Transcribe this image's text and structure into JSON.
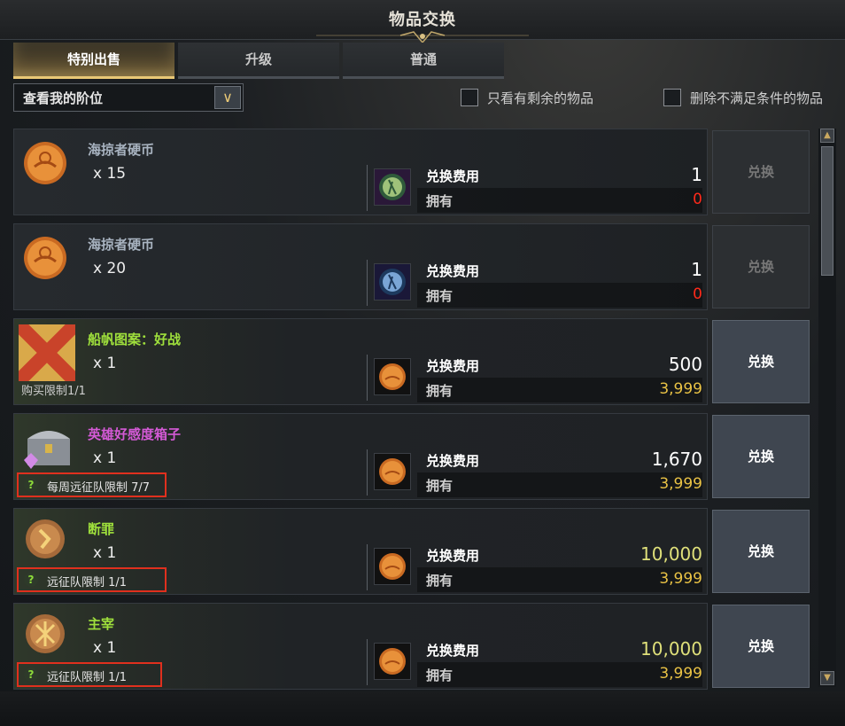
{
  "window": {
    "title": "物品交换"
  },
  "tabs": [
    {
      "label": "特别出售",
      "active": true
    },
    {
      "label": "升级",
      "active": false
    },
    {
      "label": "普通",
      "active": false
    }
  ],
  "filters": {
    "rank_select": "查看我的阶位",
    "only_remaining": "只看有剩余的物品",
    "remove_unmet": "删除不满足条件的物品"
  },
  "labels": {
    "cost": "兑换费用",
    "own": "拥有",
    "exchange": "兑换"
  },
  "items": [
    {
      "name": "海掠者硬币",
      "qty": "x 15",
      "limit": "",
      "cost": "1",
      "own": "0",
      "own_color": "red",
      "enabled": false,
      "icon": "pirate-coin-icon",
      "cost_icon": "green-figure-token-icon"
    },
    {
      "name": "海掠者硬币",
      "qty": "x 20",
      "limit": "",
      "cost": "1",
      "own": "0",
      "own_color": "red",
      "enabled": false,
      "icon": "pirate-coin-icon",
      "cost_icon": "blue-figure-token-icon"
    },
    {
      "name": "船帆图案：好战",
      "qty": "x 1",
      "limit": "购买限制1/1",
      "cost": "500",
      "own": "3,999",
      "own_color": "gold",
      "enabled": true,
      "icon": "sail-pattern-icon",
      "cost_icon": "pirate-coin-icon"
    },
    {
      "name": "英雄好感度箱子",
      "qty": "x 1",
      "limit": "每周远征队限制 7/7",
      "cost": "1,670",
      "own": "3,999",
      "own_color": "gold",
      "enabled": true,
      "icon": "treasure-chest-icon",
      "cost_icon": "pirate-coin-icon"
    },
    {
      "name": "断罪",
      "qty": "x 1",
      "limit": "远征队限制 1/1",
      "cost": "10,000",
      "own": "3,999",
      "own_color": "gold",
      "enabled": true,
      "icon": "rune-stone-icon",
      "cost_icon": "pirate-coin-icon"
    },
    {
      "name": "主宰",
      "qty": "x 1",
      "limit": "远征队限制 1/1",
      "cost": "10,000",
      "own": "3,999",
      "own_color": "gold",
      "enabled": true,
      "icon": "rune-stone-icon",
      "cost_icon": "pirate-coin-icon"
    }
  ]
}
